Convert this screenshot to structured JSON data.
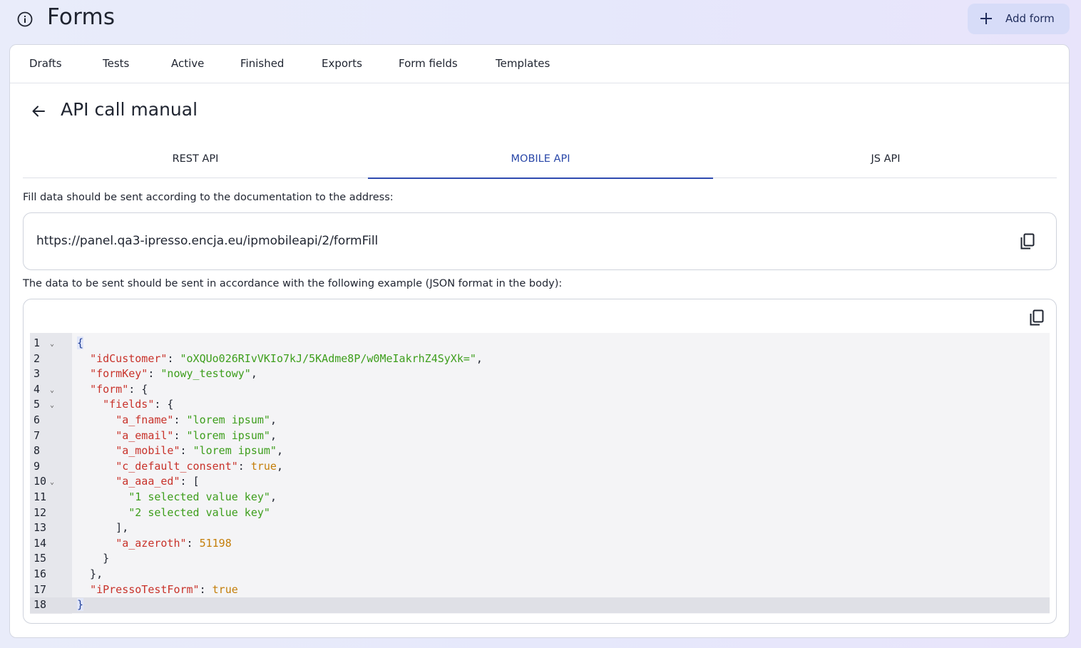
{
  "header": {
    "title": "Forms",
    "add_button_label": "Add form"
  },
  "top_tabs": [
    {
      "label": "Drafts"
    },
    {
      "label": "Tests"
    },
    {
      "label": "Active"
    },
    {
      "label": "Finished"
    },
    {
      "label": "Exports"
    },
    {
      "label": "Form fields"
    },
    {
      "label": "Templates"
    }
  ],
  "section": {
    "title": "API call manual"
  },
  "api_tabs": [
    {
      "label": "REST API",
      "active": false
    },
    {
      "label": "MOBILE API",
      "active": true
    },
    {
      "label": "JS API",
      "active": false
    }
  ],
  "fill_description": "Fill data should be sent according to the documentation to the address:",
  "endpoint_url": "https://panel.qa3-ipresso.encja.eu/ipmobileapi/2/formFill",
  "example_description": "The data to be sent should be sent in accordance with the following example (JSON format in the body):",
  "code_lines": [
    {
      "n": "1",
      "fold": true,
      "html": "<span class=\"brace-hl\">{</span>"
    },
    {
      "n": "2",
      "fold": false,
      "html": "  <span class=\"k\">\"idCustomer\"</span>: <span class=\"s\">\"oXQUo026RIvVKIo7kJ/5KAdme8P/w0MeIakrhZ4SyXk=\"</span>,"
    },
    {
      "n": "3",
      "fold": false,
      "html": "  <span class=\"k\">\"formKey\"</span>: <span class=\"s\">\"nowy_testowy\"</span>,"
    },
    {
      "n": "4",
      "fold": true,
      "html": "  <span class=\"k\">\"form\"</span>: {"
    },
    {
      "n": "5",
      "fold": true,
      "html": "    <span class=\"k\">\"fields\"</span>: {"
    },
    {
      "n": "6",
      "fold": false,
      "html": "      <span class=\"k\">\"a_fname\"</span>: <span class=\"s\">\"lorem ipsum\"</span>,"
    },
    {
      "n": "7",
      "fold": false,
      "html": "      <span class=\"k\">\"a_email\"</span>: <span class=\"s\">\"lorem ipsum\"</span>,"
    },
    {
      "n": "8",
      "fold": false,
      "html": "      <span class=\"k\">\"a_mobile\"</span>: <span class=\"s\">\"lorem ipsum\"</span>,"
    },
    {
      "n": "9",
      "fold": false,
      "html": "      <span class=\"k\">\"c_default_consent\"</span>: <span class=\"b\">true</span>,"
    },
    {
      "n": "10",
      "fold": true,
      "html": "      <span class=\"k\">\"a_aaa_ed\"</span>: ["
    },
    {
      "n": "11",
      "fold": false,
      "html": "        <span class=\"s\">\"1 selected value key\"</span>,"
    },
    {
      "n": "12",
      "fold": false,
      "html": "        <span class=\"s\">\"2 selected value key\"</span>"
    },
    {
      "n": "13",
      "fold": false,
      "html": "      ],"
    },
    {
      "n": "14",
      "fold": false,
      "html": "      <span class=\"k\">\"a_azeroth\"</span>: <span class=\"n\">51198</span>"
    },
    {
      "n": "15",
      "fold": false,
      "html": "    }"
    },
    {
      "n": "16",
      "fold": false,
      "html": "  },"
    },
    {
      "n": "17",
      "fold": false,
      "html": "  <span class=\"k\">\"iPressoTestForm\"</span>: <span class=\"b\">true</span>"
    },
    {
      "n": "18",
      "fold": false,
      "html": "<span class=\"brace-hl\">}</span>"
    }
  ],
  "colors": {
    "accent": "#2f4bb0",
    "json_key": "#c8322a",
    "json_string": "#3d9e1c",
    "json_literal": "#c47e09"
  }
}
